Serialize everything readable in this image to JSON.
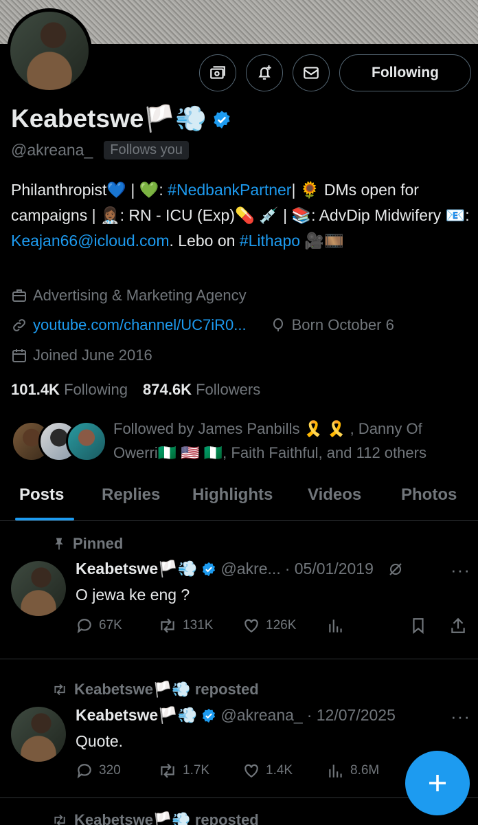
{
  "profile": {
    "name": "Keabetswe🏳️💨",
    "handle": "@akreana_",
    "follows_you": "Follows you",
    "follow_button": "Following",
    "bio": {
      "line1_a": "Philanthropist💙 | 💚: ",
      "hashtag1": "#NedbankPartner",
      "line1_b": "| 🌻 DMs open for campaigns | 👩🏾‍⚕️: RN - ICU (Exp)💊 💉 | 📚: AdvDip Midwifery 📧: ",
      "email": "Keajan66@icloud.com",
      "line_c": ". Lebo on ",
      "hashtag2": "#Lithapo",
      "line_d": " 🎥🎞️"
    },
    "category": "Advertising & Marketing Agency",
    "website": "youtube.com/channel/UC7iR0...",
    "birthday": "Born October 6",
    "joined": "Joined June 2016",
    "following_count": "101.4K",
    "following_label": "Following",
    "followers_count": "874.6K",
    "followers_label": "Followers",
    "followed_by": "Followed by James Panbills 🎗️ 🎗️ , Danny Of Owerri🇳🇬 🇺🇸 🇳🇬, Faith Faithful, and 112 others"
  },
  "tabs": [
    "Posts",
    "Replies",
    "Highlights",
    "Videos",
    "Photos"
  ],
  "posts": [
    {
      "context": "Pinned",
      "name": "Keabetswe🏳️💨",
      "handle": "@akre...",
      "date": "· 05/01/2019",
      "text": "O jewa ke eng ?",
      "replies": "67K",
      "reposts": "131K",
      "likes": "126K"
    },
    {
      "context": "Keabetswe🏳️💨 reposted",
      "name": "Keabetswe🏳️💨",
      "handle": "@akreana_",
      "date": "· 12/07/2025",
      "text": "Quote.",
      "replies": "320",
      "reposts": "1.7K",
      "likes": "1.4K",
      "views": "8.6M"
    },
    {
      "context": "Keabetswe🏳️💨 reposted"
    }
  ],
  "colors": {
    "accent": "#1d9bf0",
    "muted": "#71767b",
    "bg": "#000000"
  }
}
